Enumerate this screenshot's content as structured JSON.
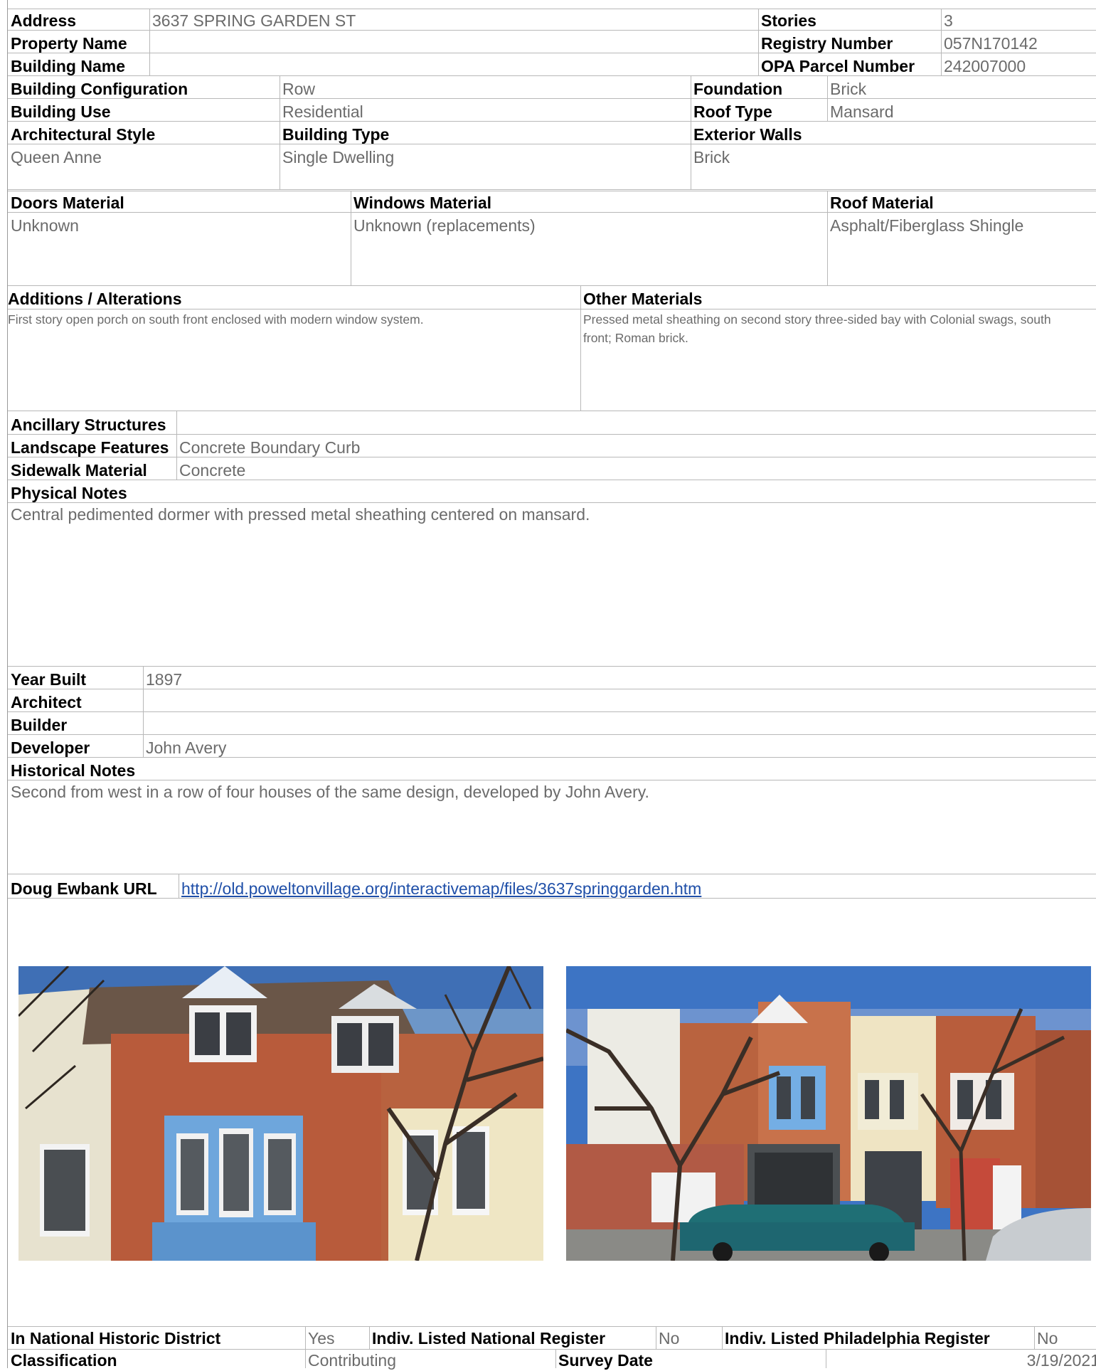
{
  "header": {
    "address_label": "Address",
    "address": "3637 SPRING GARDEN ST",
    "stories_label": "Stories",
    "stories": "3",
    "property_name_label": "Property Name",
    "property_name": "",
    "registry_label": "Registry Number",
    "registry": "057N170142",
    "building_name_label": "Building Name",
    "building_name": "",
    "opa_label": "OPA Parcel Number",
    "opa": "242007000"
  },
  "building": {
    "config_label": "Building Configuration",
    "config": "Row",
    "foundation_label": "Foundation",
    "foundation": "Brick",
    "use_label": "Building Use",
    "use": "Residential",
    "roof_type_label": "Roof Type",
    "roof_type": "Mansard",
    "arch_style_label": "Architectural Style",
    "arch_style": "Queen Anne",
    "type_label": "Building Type",
    "type": "Single Dwelling",
    "ext_walls_label": "Exterior Walls",
    "ext_walls": "Brick"
  },
  "materials": {
    "doors_label": "Doors Material",
    "doors": "Unknown",
    "windows_label": "Windows Material",
    "windows": "Unknown (replacements)",
    "roof_label": "Roof Material",
    "roof": "Asphalt/Fiberglass Shingle"
  },
  "alterations": {
    "additions_label": "Additions / Alterations",
    "additions": "First story open porch on south front enclosed with modern window system.",
    "other_label": "Other Materials",
    "other": "Pressed metal sheathing on second story three-sided bay with Colonial swags, south front; Roman brick."
  },
  "site": {
    "ancillary_label": "Ancillary Structures",
    "ancillary": "",
    "landscape_label": "Landscape Features",
    "landscape": "Concrete Boundary Curb",
    "sidewalk_label": "Sidewalk Material",
    "sidewalk": "Concrete",
    "physical_label": "Physical Notes",
    "physical": "Central pedimented dormer with pressed metal sheathing centered on mansard."
  },
  "history": {
    "year_label": "Year Built",
    "year": "1897",
    "architect_label": "Architect",
    "architect": "",
    "builder_label": "Builder",
    "builder": "",
    "developer_label": "Developer",
    "developer": "John Avery",
    "notes_label": "Historical Notes",
    "notes": "Second from west in a row of four houses of the same design, developed by John Avery.",
    "url_label": "Doug Ewbank URL",
    "url": "http://old.poweltonvillage.org/interactivemap/files/3637springgarden.htm"
  },
  "photos": {
    "left_name": "front-elevation-photo",
    "right_name": "streetscape-photo"
  },
  "footer": {
    "nhd_label": "In National Historic District",
    "nhd": "Yes",
    "nat_reg_label": "Indiv. Listed National Register",
    "nat_reg": "No",
    "phila_reg_label": "Indiv. Listed Philadelphia Register",
    "phila_reg": "No",
    "class_label": "Classification",
    "class": "Contributing",
    "survey_label": "Survey Date",
    "survey": "3/19/2021"
  },
  "colors": {
    "label": "#000000",
    "value": "#6b6b6b",
    "rule": "#b8b8b8",
    "link": "#1f4fa8"
  }
}
